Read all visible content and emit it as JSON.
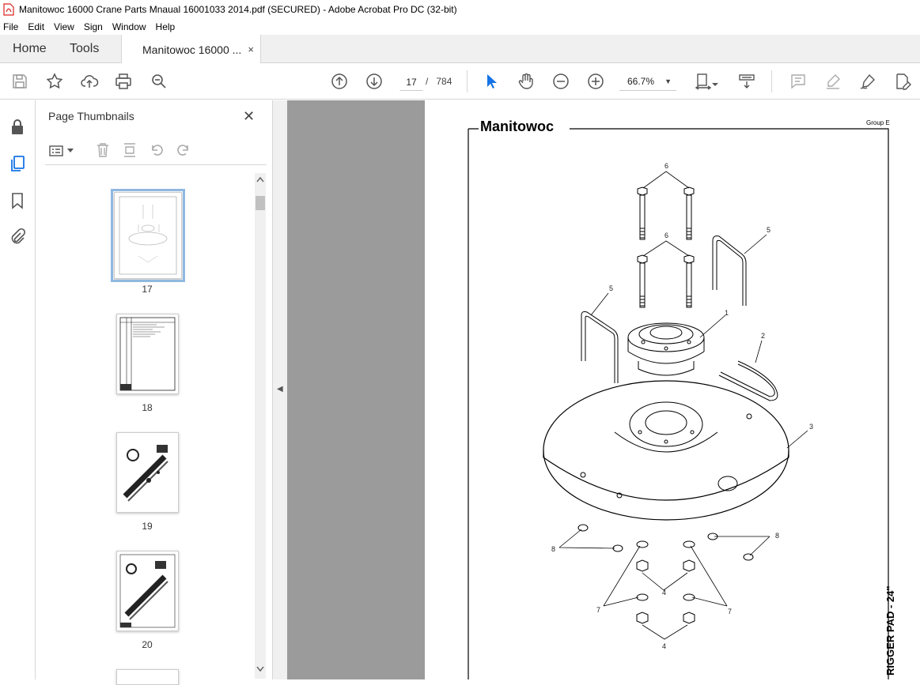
{
  "window": {
    "title": "Manitowoc 16000 Crane Parts Mnaual 16001033 2014.pdf (SECURED) - Adobe Acrobat Pro DC (32-bit)"
  },
  "menu": [
    "File",
    "Edit",
    "View",
    "Sign",
    "Window",
    "Help"
  ],
  "tabs": {
    "home": "Home",
    "tools": "Tools",
    "document": "Manitowoc 16000 ...",
    "close": "×"
  },
  "toolbar": {
    "current_page": "17",
    "page_sep": "/",
    "total_pages": "784",
    "zoom": "66.7%"
  },
  "thumbnails_panel": {
    "title": "Page Thumbnails",
    "close": "✕",
    "pages": [
      "17",
      "18",
      "19",
      "20"
    ]
  },
  "document_page": {
    "brand": "Manitowoc",
    "group": "Group E",
    "side_title": "RIGGER PAD - 24\"",
    "callouts": [
      "6",
      "6",
      "5",
      "5",
      "1",
      "2",
      "3",
      "8",
      "8",
      "4",
      "4",
      "7",
      "7"
    ]
  },
  "colors": {
    "accent_blue": "#1473e6",
    "gray_canvas": "#9b9b9b",
    "selected_outline": "#8fb8e0"
  }
}
